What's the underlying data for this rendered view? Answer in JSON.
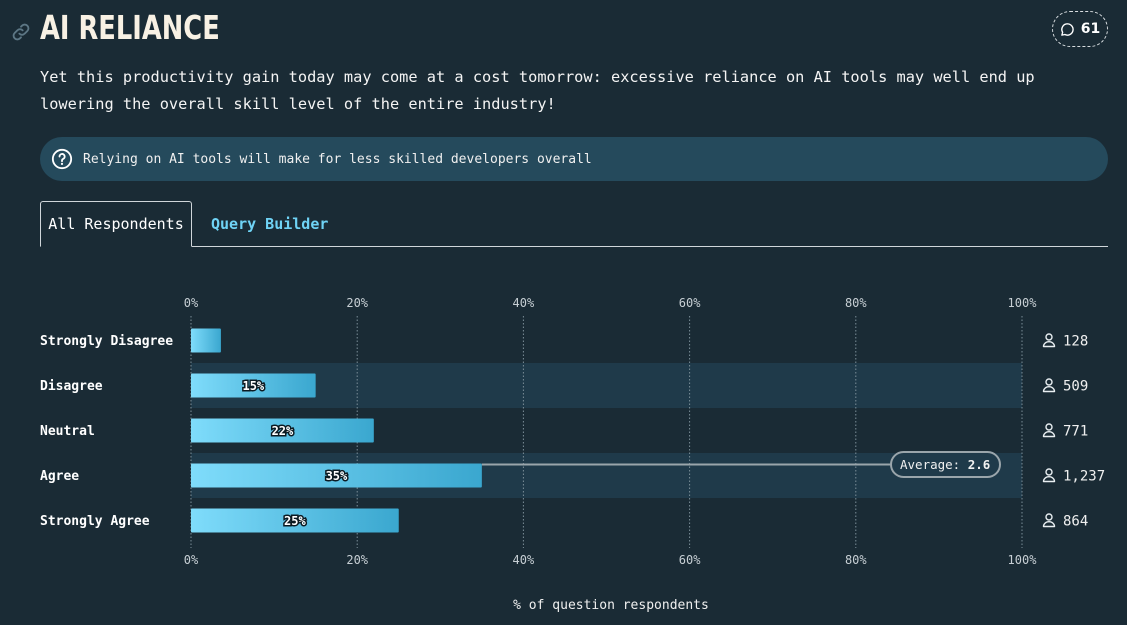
{
  "header": {
    "title": "AI RELIANCE",
    "comment_count": "61"
  },
  "intro": "Yet this productivity gain today may come at a cost tomorrow: excessive reliance on AI tools may well end up lowering the overall skill level of the entire industry!",
  "question": "Relying on AI tools will make for less skilled developers overall",
  "tabs": [
    {
      "label": "All Respondents",
      "active": true
    },
    {
      "label": "Query Builder",
      "active": false
    }
  ],
  "colors": {
    "background": "#1a2b35",
    "bar_light": "#7fdcfb",
    "bar_dark": "#3aa7cf",
    "accent": "#6fd3f5",
    "highlight_row": "#1f3a4a"
  },
  "chart_data": {
    "type": "bar",
    "orientation": "horizontal",
    "categories": [
      "Strongly Disagree",
      "Disagree",
      "Neutral",
      "Agree",
      "Strongly Agree"
    ],
    "values": [
      3.6,
      15,
      22,
      35,
      25
    ],
    "value_labels": [
      "",
      "15%",
      "22%",
      "35%",
      "25%"
    ],
    "counts": [
      "128",
      "509",
      "771",
      "1,237",
      "864"
    ],
    "xlim": [
      0,
      100
    ],
    "ticks": [
      "0%",
      "20%",
      "40%",
      "60%",
      "80%",
      "100%"
    ],
    "xlabel": "% of question respondents",
    "grid": true,
    "average": {
      "label": "Average:",
      "value": "2.6",
      "category_index": 3
    },
    "highlighted_rows": [
      1,
      3
    ]
  }
}
